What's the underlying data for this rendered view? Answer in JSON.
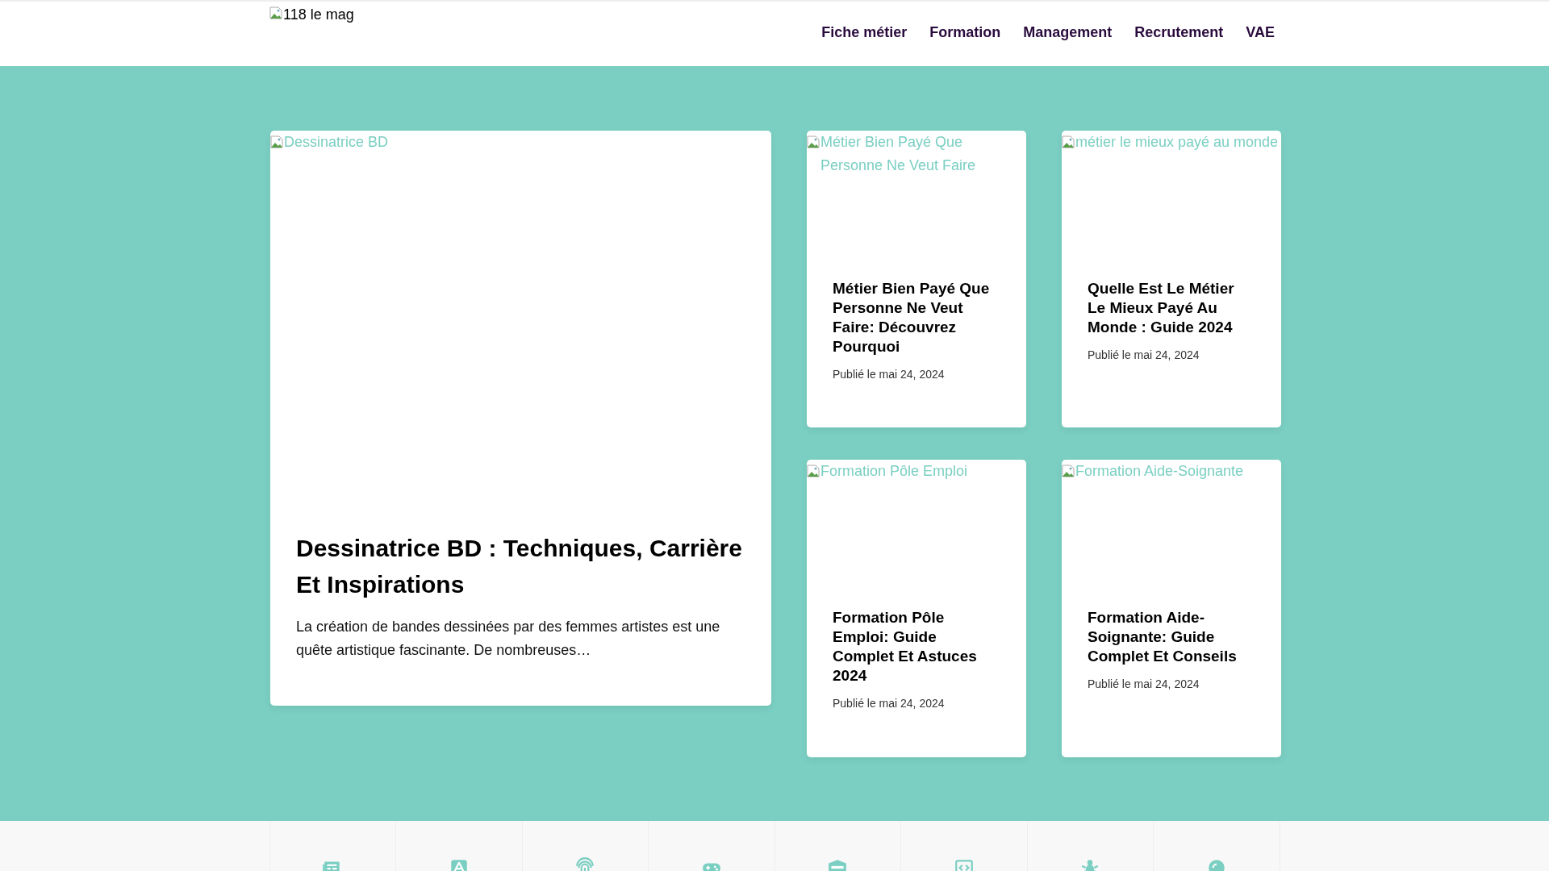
{
  "header": {
    "logo_alt": "118 le mag",
    "nav": [
      {
        "label": "Fiche métier"
      },
      {
        "label": "Formation"
      },
      {
        "label": "Management"
      },
      {
        "label": "Recrutement"
      },
      {
        "label": "VAE"
      }
    ]
  },
  "featured": {
    "image_alt": "Dessinatrice BD",
    "title": "Dessinatrice BD : Techniques, Carrière Et Inspirations",
    "excerpt": "La création de bandes dessinées par des femmes artistes est une quête artistique fascinante. De nombreuses…"
  },
  "posts": [
    {
      "image_alt": "Métier Bien Payé Que Personne Ne Veut Faire",
      "title": "Métier Bien Payé Que Personne Ne Veut Faire: Découvrez Pourquoi",
      "date": "Publié le mai 24, 2024"
    },
    {
      "image_alt": "métier le mieux payé au monde",
      "title": "Quelle Est Le Métier Le Mieux Payé Au Monde : Guide 2024",
      "date": "Publié le mai 24, 2024"
    },
    {
      "image_alt": "Formation Pôle Emploi",
      "title": "Formation Pôle Emploi: Guide Complet Et Astuces 2024",
      "date": "Publié le mai 24, 2024"
    },
    {
      "image_alt": "Formation Aide-Soignante",
      "title": "Formation Aide-Soignante: Guide Complet Et Conseils",
      "date": "Publié le mai 24, 2024"
    }
  ]
}
